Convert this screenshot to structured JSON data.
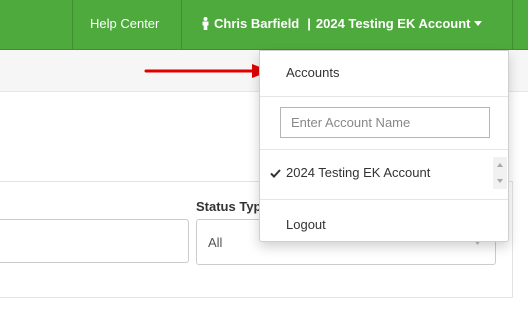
{
  "navbar": {
    "help_label": "Help Center",
    "user_name": "Chris Barfield",
    "separator": "|",
    "account_name": "2024 Testing EK Account",
    "background_color": "#4faa3e"
  },
  "filters": {
    "status_label": "Status Typ",
    "status_value": "All"
  },
  "dropdown": {
    "accounts_label": "Accounts",
    "search_placeholder": "Enter Account Name",
    "search_value": "",
    "accounts": [
      {
        "label": "2024 Testing EK Account",
        "selected": true
      }
    ],
    "logout_label": "Logout"
  },
  "annotation": {
    "arrow_color": "#e00000",
    "points_to": "Accounts"
  },
  "icons": {
    "user": "user-icon",
    "caret": "caret-down-icon",
    "check": "check-icon",
    "scroll_up": "scroll-up-icon",
    "scroll_down": "scroll-down-icon"
  }
}
